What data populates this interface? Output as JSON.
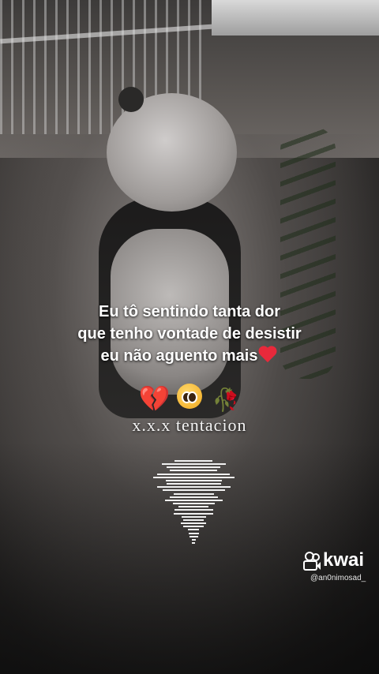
{
  "caption": {
    "line1": "Eu tô sentindo tanta dor",
    "line2": "que tenho vontade de desistir",
    "line3": "eu não aguento mais"
  },
  "emojis": {
    "heart": "heart-with-ribbon",
    "broken_heart": "💔",
    "pleading_face": "pleading-face",
    "wilted_rose": "🥀"
  },
  "signature": "x.x.x tentacion",
  "watermark": {
    "brand": "kwai",
    "handle": "@an0nimosad_"
  },
  "colors": {
    "caption_text": "#ffffff",
    "accent_heart": "#e8293b"
  }
}
